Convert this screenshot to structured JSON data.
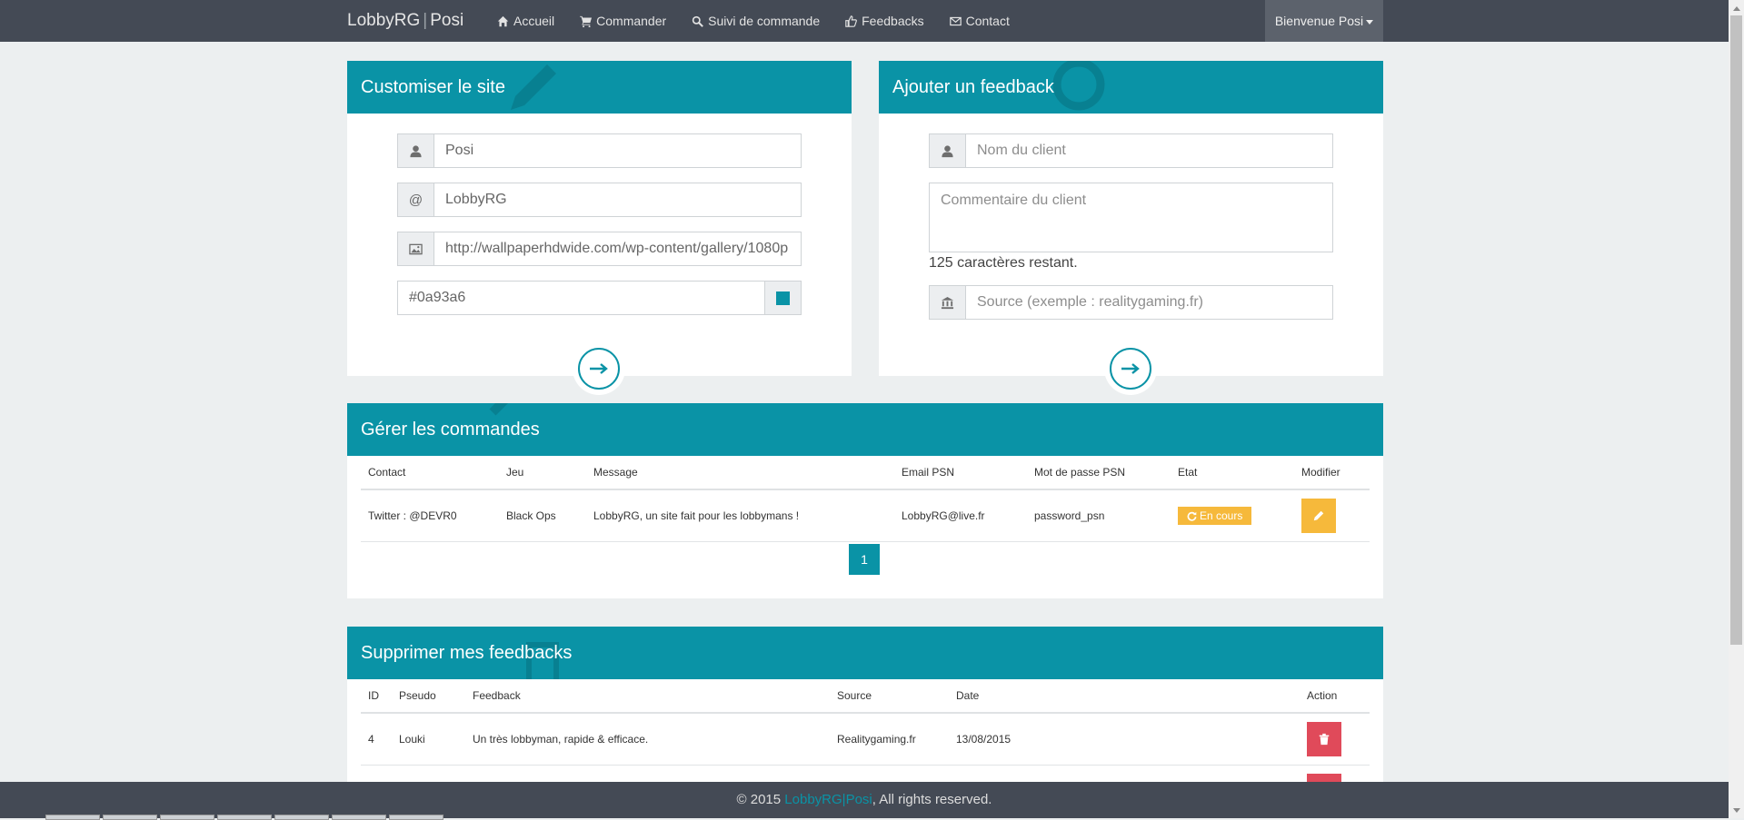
{
  "brand": {
    "name1": "LobbyRG",
    "sep": "|",
    "name2": "Posi"
  },
  "nav": {
    "items": [
      {
        "label": "Accueil",
        "icon": "home-icon"
      },
      {
        "label": "Commander",
        "icon": "cart-icon"
      },
      {
        "label": "Suivi de commande",
        "icon": "search-icon"
      },
      {
        "label": "Feedbacks",
        "icon": "thumbs-up-icon"
      },
      {
        "label": "Contact",
        "icon": "envelope-icon"
      }
    ],
    "user_menu": "Bienvenue Posi"
  },
  "customize": {
    "title": "Customiser le site",
    "name_value": "Posi",
    "site_value": "LobbyRG",
    "at_symbol": "@",
    "bg_value": "http://wallpaperhdwide.com/wp-content/gallery/1080p",
    "color_value": "#0a93a6",
    "swatch_color": "#0a93a6"
  },
  "feedback_form": {
    "title": "Ajouter un feedback",
    "name_placeholder": "Nom du client",
    "comment_placeholder": "Commentaire du client",
    "chars_left": "125 caractères restant.",
    "source_placeholder": "Source (exemple : realitygaming.fr)"
  },
  "orders": {
    "title": "Gérer les commandes",
    "headers": [
      "Contact",
      "Jeu",
      "Message",
      "Email PSN",
      "Mot de passe PSN",
      "Etat",
      "Modifier"
    ],
    "rows": [
      {
        "contact": "Twitter : @DEVR0",
        "game": "Black Ops",
        "message": "LobbyRG, un site fait pour les lobbymans !",
        "email": "LobbyRG@live.fr",
        "password": "password_psn",
        "status": "En cours"
      }
    ],
    "page": "1"
  },
  "feedbacks": {
    "title": "Supprimer mes feedbacks",
    "headers": [
      "ID",
      "Pseudo",
      "Feedback",
      "Source",
      "Date",
      "Action"
    ],
    "rows": [
      {
        "id": "4",
        "pseudo": "Louki",
        "feedback": "Un très lobbyman, rapide & efficace.",
        "source": "Realitygaming.fr",
        "date": "13/08/2015"
      }
    ]
  },
  "footer": {
    "prefix": "© 2015 ",
    "brand": "LobbyRG|Posi",
    "suffix": ", All rights reserved."
  },
  "colors": {
    "accent": "#0a93a6",
    "warning": "#f6b93b",
    "danger": "#e04a5a",
    "navbar": "#444a55"
  }
}
